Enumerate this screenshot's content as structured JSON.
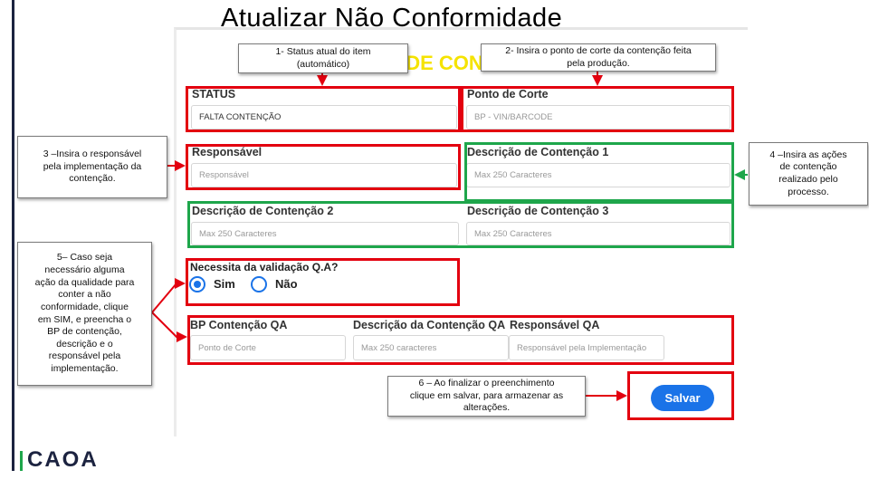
{
  "slide": {
    "title": "Atualizar Não Conformidade",
    "background_heading": "O DE CON",
    "logo": "CAOA"
  },
  "form": {
    "status": {
      "label": "STATUS",
      "value": "FALTA CONTENÇÃO"
    },
    "ponto_de_corte": {
      "label": "Ponto de Corte",
      "placeholder": "BP - VIN/BARCODE"
    },
    "responsavel": {
      "label": "Responsável",
      "placeholder": "Responsável"
    },
    "descricao_1": {
      "label": "Descrição de Contenção 1",
      "placeholder": "Max 250 Caracteres"
    },
    "descricao_2": {
      "label": "Descrição de Contenção 2",
      "placeholder": "Max 250 Caracteres"
    },
    "descricao_3": {
      "label": "Descrição de Contenção 3",
      "placeholder": "Max 250 Caracteres"
    },
    "validacao_qa": {
      "label": "Necessita da validação Q.A?",
      "options": [
        {
          "label": "Sim",
          "checked": true
        },
        {
          "label": "Não",
          "checked": false
        }
      ]
    },
    "bp_contencao_qa": {
      "label": "BP Contenção QA",
      "placeholder": "Ponto de Corte"
    },
    "descricao_contencao_qa": {
      "label": "Descrição da Contenção QA",
      "placeholder": "Max 250 caracteres"
    },
    "responsavel_qa": {
      "label": "Responsável QA",
      "placeholder": "Responsável pela Implementação"
    },
    "save_label": "Salvar"
  },
  "callouts": {
    "c1": [
      "1- Status atual do item",
      "(automático)"
    ],
    "c2": [
      "2- Insira o ponto de corte da contenção feita",
      "pela produção."
    ],
    "c3": [
      "3 –Insira o responsável",
      "pela implementação da",
      "contenção."
    ],
    "c4": [
      "4 –Insira as ações",
      "de contenção",
      "realizado pelo",
      "processo."
    ],
    "c5": [
      "5– Caso seja",
      "necessário alguma",
      "ação da qualidade para",
      "conter a não",
      "conformidade, clique",
      "em SIM, e preencha o",
      "BP de contenção,",
      "descrição e o",
      "responsável pela",
      "implementação."
    ],
    "c6": [
      "6 – Ao finalizar o preenchimento",
      "clique em salvar, para armazenar as",
      "alterações."
    ]
  },
  "colors": {
    "annotation_red": "#e3000f",
    "annotation_green": "#1ea64b",
    "button_blue": "#1a73e8",
    "heading_yellow": "#f5e300"
  }
}
